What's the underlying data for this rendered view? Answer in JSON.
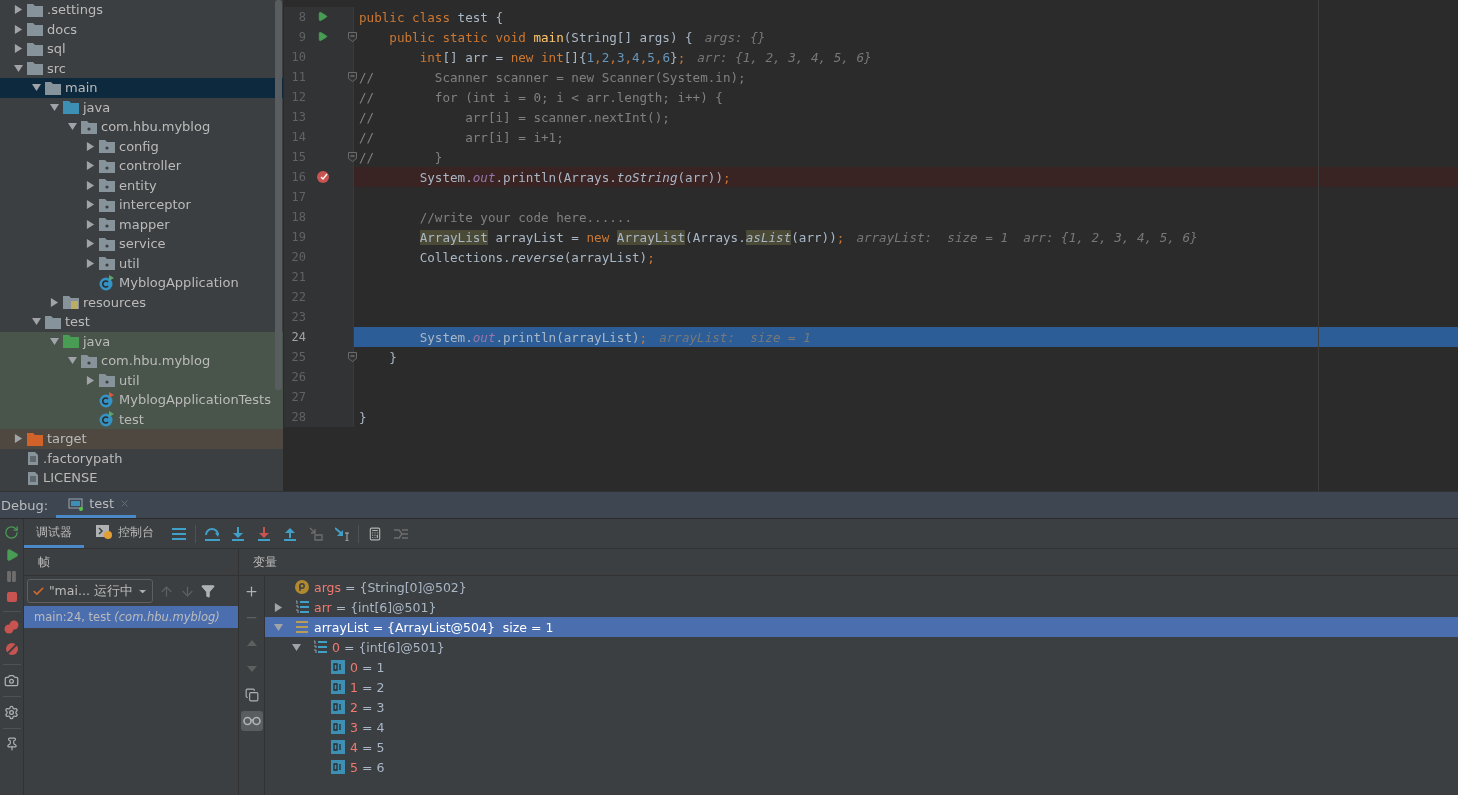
{
  "project_tree": [
    {
      "label": ".settings",
      "kind": "folder",
      "expanded": false
    },
    {
      "label": "docs",
      "kind": "folder",
      "expanded": false
    },
    {
      "label": "sql",
      "kind": "folder",
      "expanded": false
    },
    {
      "label": "src",
      "kind": "folder",
      "expanded": true,
      "children": [
        {
          "label": "main",
          "kind": "folder",
          "expanded": true,
          "selected": true,
          "children": [
            {
              "label": "java",
              "kind": "source",
              "expanded": true,
              "children": [
                {
                  "label": "com.hbu.myblog",
                  "kind": "package",
                  "expanded": true,
                  "children": [
                    {
                      "label": "config",
                      "kind": "package",
                      "expanded": false
                    },
                    {
                      "label": "controller",
                      "kind": "package",
                      "expanded": false
                    },
                    {
                      "label": "entity",
                      "kind": "package",
                      "expanded": false
                    },
                    {
                      "label": "interceptor",
                      "kind": "package",
                      "expanded": false
                    },
                    {
                      "label": "mapper",
                      "kind": "package",
                      "expanded": false
                    },
                    {
                      "label": "service",
                      "kind": "package",
                      "expanded": false
                    },
                    {
                      "label": "util",
                      "kind": "package",
                      "expanded": false
                    },
                    {
                      "label": "MyblogApplication",
                      "kind": "app"
                    }
                  ]
                }
              ]
            },
            {
              "label": "resources",
              "kind": "resources",
              "expanded": false
            }
          ]
        },
        {
          "label": "test",
          "kind": "folder",
          "expanded": true,
          "children": [
            {
              "label": "java",
              "kind": "testsource",
              "expanded": true,
              "in_test_root": true,
              "children": [
                {
                  "label": "com.hbu.myblog",
                  "kind": "package",
                  "expanded": true,
                  "in_test_root": true,
                  "children": [
                    {
                      "label": "util",
                      "kind": "package",
                      "expanded": false,
                      "in_test_root": true
                    },
                    {
                      "label": "MyblogApplicationTests",
                      "kind": "testclass",
                      "in_test_root": true
                    },
                    {
                      "label": "test",
                      "kind": "runclass",
                      "in_test_root": true
                    }
                  ]
                }
              ]
            }
          ]
        }
      ]
    },
    {
      "label": "target",
      "kind": "excluded",
      "expanded": false,
      "excluded": true
    },
    {
      "label": ".factorypath",
      "kind": "file"
    },
    {
      "label": "LICENSE",
      "kind": "file"
    }
  ],
  "editor": {
    "lines": [
      {
        "number": "8",
        "run_marker": true,
        "tokens": [
          {
            "kind": "kw",
            "text": "public class "
          },
          {
            "kind": "pl",
            "text": "test {"
          }
        ]
      },
      {
        "number": "9",
        "run_marker": true,
        "fold": true,
        "tokens": [
          {
            "kind": "kw",
            "text": "    public static void "
          },
          {
            "kind": "fn",
            "text": "main"
          },
          {
            "kind": "pl",
            "text": "(String[] args) {"
          },
          {
            "kind": "hint",
            "text": "args: {}"
          }
        ]
      },
      {
        "number": "10",
        "tokens": [
          {
            "kind": "kw",
            "text": "        int"
          },
          {
            "kind": "pl",
            "text": "[] arr = "
          },
          {
            "kind": "kw",
            "text": "new int"
          },
          {
            "kind": "pl",
            "text": "[]{"
          },
          {
            "kind": "num",
            "text": "1"
          },
          {
            "kind": "kw",
            "text": ","
          },
          {
            "kind": "num",
            "text": "2"
          },
          {
            "kind": "kw",
            "text": ","
          },
          {
            "kind": "num",
            "text": "3"
          },
          {
            "kind": "kw",
            "text": ","
          },
          {
            "kind": "num",
            "text": "4"
          },
          {
            "kind": "kw",
            "text": ","
          },
          {
            "kind": "num",
            "text": "5"
          },
          {
            "kind": "kw",
            "text": ","
          },
          {
            "kind": "num",
            "text": "6"
          },
          {
            "kind": "pl",
            "text": "}"
          },
          {
            "kind": "kw",
            "text": ";"
          },
          {
            "kind": "hint",
            "text": "arr: {1, 2, 3, 4, 5, 6}"
          }
        ]
      },
      {
        "number": "11",
        "fold": true,
        "tokens": [
          {
            "kind": "cm",
            "text": "//        Scanner scanner = new Scanner(System.in);"
          }
        ]
      },
      {
        "number": "12",
        "tokens": [
          {
            "kind": "cm",
            "text": "//        for (int i = 0; i < arr.length; i++) {"
          }
        ]
      },
      {
        "number": "13",
        "tokens": [
          {
            "kind": "cm",
            "text": "//            arr[i] = scanner.nextInt();"
          }
        ]
      },
      {
        "number": "14",
        "tokens": [
          {
            "kind": "cm",
            "text": "//            arr[i] = i+1;"
          }
        ]
      },
      {
        "number": "15",
        "fold": true,
        "tokens": [
          {
            "kind": "cm",
            "text": "//        }"
          }
        ]
      },
      {
        "number": "16",
        "breakpoint": true,
        "tokens": [
          {
            "kind": "pl",
            "text": "        System."
          },
          {
            "kind": "st",
            "text": "out"
          },
          {
            "kind": "pl",
            "text": ".println(Arrays."
          },
          {
            "kind": "it",
            "text": "toString"
          },
          {
            "kind": "pl",
            "text": "(arr))"
          },
          {
            "kind": "kw",
            "text": ";"
          }
        ]
      },
      {
        "number": "17"
      },
      {
        "number": "18",
        "tokens": [
          {
            "kind": "cm",
            "text": "        //write your code here......"
          }
        ]
      },
      {
        "number": "19",
        "tokens": [
          {
            "kind": "use",
            "text": "        ArrayList"
          },
          {
            "kind": "pl",
            "text": " arrayList = "
          },
          {
            "kind": "kw",
            "text": "new "
          },
          {
            "kind": "use",
            "text": "ArrayList"
          },
          {
            "kind": "pl",
            "text": "(Arrays."
          },
          {
            "kind": "useit",
            "text": "asList"
          },
          {
            "kind": "pl",
            "text": "(arr))"
          },
          {
            "kind": "kw",
            "text": ";"
          },
          {
            "kind": "hint",
            "text": "arrayList:  size = 1  arr: {1, 2, 3, 4, 5, 6}"
          }
        ]
      },
      {
        "number": "20",
        "tokens": [
          {
            "kind": "pl",
            "text": "        Collections."
          },
          {
            "kind": "it",
            "text": "reverse"
          },
          {
            "kind": "pl",
            "text": "(arrayList)"
          },
          {
            "kind": "kw",
            "text": ";"
          }
        ]
      },
      {
        "number": "21"
      },
      {
        "number": "22"
      },
      {
        "number": "23"
      },
      {
        "number": "24",
        "current": true,
        "tokens": [
          {
            "kind": "pl",
            "text": "        System."
          },
          {
            "kind": "st",
            "text": "out"
          },
          {
            "kind": "pl",
            "text": ".println(arrayList)"
          },
          {
            "kind": "kw",
            "text": ";"
          },
          {
            "kind": "hint",
            "text": "arrayList:  size = 1"
          }
        ]
      },
      {
        "number": "25",
        "fold": true,
        "tokens": [
          {
            "kind": "pl",
            "text": "    }"
          }
        ]
      },
      {
        "number": "26"
      },
      {
        "number": "27"
      },
      {
        "number": "28",
        "tokens": [
          {
            "kind": "pl",
            "text": "}"
          }
        ]
      }
    ]
  },
  "debug": {
    "label": "Debug:",
    "session_tab": {
      "label": "test",
      "selected": true
    },
    "tabs": [
      {
        "label": "调试器",
        "selected": true,
        "kind": "plain"
      },
      {
        "label": "控制台",
        "selected": false,
        "kind": "console"
      }
    ],
    "frames": {
      "title": "帧",
      "thread": "\"mai... 运行中",
      "items": [
        {
          "text": "main:24, test *(com.hbu.myblog)*",
          "selected": true
        }
      ]
    },
    "variables": {
      "title": "变量",
      "items": [
        {
          "name": "args",
          "value": "= {String[0]@502}",
          "kind": "param",
          "selected": false
        },
        {
          "name": "arr",
          "value": "= {int[6]@501}",
          "kind": "array",
          "expanded": false,
          "selected": false
        },
        {
          "name": "arrayList",
          "value": "= {ArrayList@504}  size = 1",
          "kind": "list",
          "expanded": true,
          "selected": true,
          "children": [
            {
              "name": "0",
              "value": "= {int[6]@501}",
              "kind": "array",
              "expanded": true,
              "selected": false,
              "children": [
                {
                  "name": "0",
                  "value": "= 1",
                  "kind": "primitive",
                  "selected": false
                },
                {
                  "name": "1",
                  "value": "= 2",
                  "kind": "primitive",
                  "selected": false
                },
                {
                  "name": "2",
                  "value": "= 3",
                  "kind": "primitive",
                  "selected": false
                },
                {
                  "name": "3",
                  "value": "= 4",
                  "kind": "primitive",
                  "selected": false
                },
                {
                  "name": "4",
                  "value": "= 5",
                  "kind": "primitive",
                  "selected": false
                },
                {
                  "name": "5",
                  "value": "= 6",
                  "kind": "primitive",
                  "selected": false
                }
              ]
            }
          ]
        }
      ]
    }
  }
}
